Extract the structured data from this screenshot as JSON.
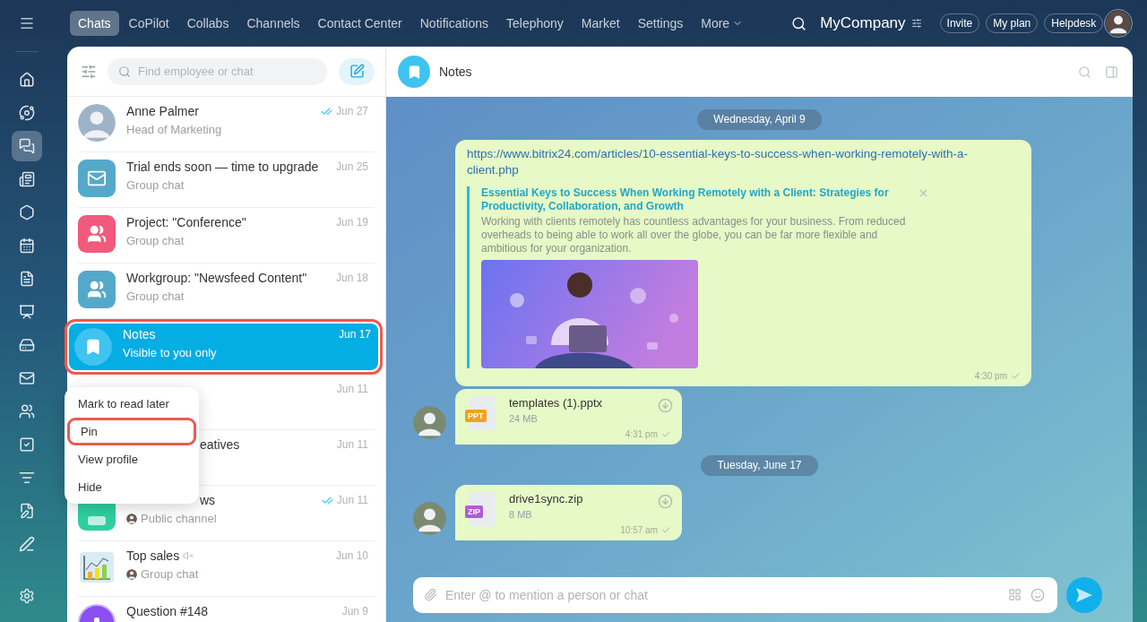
{
  "rail": {
    "items": [
      {
        "selected": false
      },
      {
        "selected": false
      },
      {
        "selected": true
      },
      {
        "selected": false
      },
      {
        "selected": false
      },
      {
        "selected": false
      },
      {
        "selected": false
      },
      {
        "selected": false
      },
      {
        "selected": false
      },
      {
        "selected": false
      },
      {
        "selected": false
      },
      {
        "selected": false
      },
      {
        "selected": false
      },
      {
        "selected": false
      },
      {
        "selected": false
      }
    ]
  },
  "top_nav": {
    "tabs": [
      {
        "label": "Chats",
        "selected": true,
        "kind": "tab"
      },
      {
        "label": "CoPilot",
        "selected": false,
        "kind": "tab"
      },
      {
        "label": "Collabs",
        "selected": false,
        "kind": "tab"
      },
      {
        "label": "Channels",
        "selected": false,
        "kind": "tab"
      },
      {
        "label": "Contact Center",
        "selected": false,
        "kind": "tab"
      },
      {
        "label": "Notifications",
        "selected": false,
        "kind": "tab"
      },
      {
        "label": "Telephony",
        "selected": false,
        "kind": "tab"
      },
      {
        "label": "Market",
        "selected": false,
        "kind": "tab"
      },
      {
        "label": "Settings",
        "selected": false,
        "kind": "tab"
      },
      {
        "label": "More",
        "selected": false,
        "kind": "dropdown"
      }
    ],
    "company": "MyCompany",
    "buttons": [
      "Invite",
      "My plan",
      "Helpdesk"
    ]
  },
  "chat_list": {
    "search": {
      "placeholder": "Find employee or chat"
    },
    "chats": [
      {
        "title": "Anne Palmer",
        "subtitle": "Head of Marketing",
        "date": "Jun 27",
        "read": true,
        "selected": false
      },
      {
        "kind": "mail",
        "color": "#54a9ca",
        "title": "Trial ends soon — time to upgrade",
        "subtitle": "Group chat",
        "date": "Jun 25",
        "selected": false
      },
      {
        "kind": "group",
        "color": "#f25a7d",
        "title": "Project: \"Conference\"",
        "subtitle": "Group chat",
        "date": "Jun 19",
        "selected": false
      },
      {
        "kind": "group",
        "color": "#54a9ca",
        "title": "Workgroup: \"Newsfeed Content\"",
        "subtitle": "Group chat",
        "date": "Jun 18",
        "selected": false
      },
      {
        "kind": "bookmark",
        "color": "#3fc3f0",
        "title": "Notes",
        "subtitle": "Visible to you only",
        "date": "Jun 17",
        "selected": true,
        "highlighted": true
      },
      {
        "kind": "hidden",
        "date": "Jun 11",
        "selected": false
      },
      {
        "kind": "hidden",
        "title": "eatives",
        "date": "Jun 11",
        "selected": false,
        "covered": true
      },
      {
        "kind": "channel",
        "color": "#2fcf9f",
        "title": "ws",
        "subtitle": "Public channel",
        "date": "Jun 11",
        "read": true,
        "selected": false,
        "subtitle_avatar": true,
        "covered": true
      },
      {
        "kind": "chart",
        "title": "Top sales",
        "subtitle": "Group chat",
        "date": "Jun 10",
        "muted": true,
        "selected": false,
        "subtitle_avatar": true
      },
      {
        "kind": "question",
        "color": "#8b4ff2",
        "title": "Question #148",
        "date": "Jun 9",
        "selected": false
      }
    ]
  },
  "context_menu": {
    "items": [
      {
        "label": "Mark to read later"
      },
      {
        "label": "Pin",
        "highlighted": true
      },
      {
        "label": "View profile"
      },
      {
        "label": "Hide"
      }
    ]
  },
  "chat": {
    "header": {
      "title": "Notes"
    },
    "messages": [
      {
        "kind": "date",
        "text": "Wednesday, April 9"
      },
      {
        "kind": "link",
        "url": "https://www.bitrix24.com/articles/10-essential-keys-to-success-when-working-remotely-with-a-client.php",
        "preview": {
          "title": "Essential Keys to Success When Working Remotely with a Client: Strategies for Productivity, Collaboration, and Growth",
          "description": "Working with clients remotely has countless advantages for your business. From reduced overheads to being able to work all over the globe, you can be far more flexible and ambitious for your organization."
        },
        "time": "4:30 pm",
        "delivered": true
      },
      {
        "kind": "file",
        "avatar": true,
        "file_type": "PPT",
        "color": "#f0a21c",
        "name": "templates (1).pptx",
        "size": "24 MB",
        "time": "4:31 pm",
        "delivered": true
      },
      {
        "kind": "date",
        "text": "Tuesday, June 17"
      },
      {
        "kind": "file",
        "avatar": true,
        "file_type": "ZIP",
        "color": "#b05cd6",
        "name": "drive1sync.zip",
        "size": "8 MB",
        "time": "10:57 am",
        "delivered": true
      }
    ],
    "composer": {
      "placeholder": "Enter @ to mention a person or chat"
    }
  }
}
